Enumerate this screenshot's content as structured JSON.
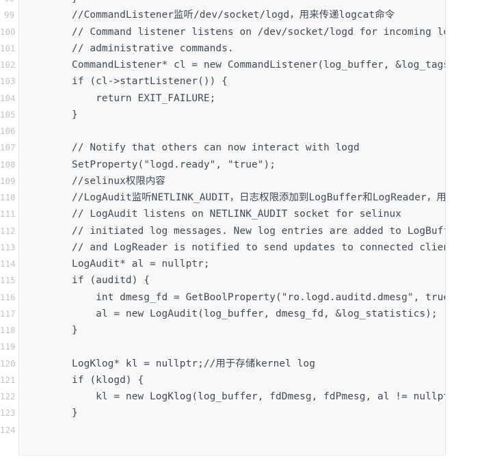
{
  "editor": {
    "language": "cpp",
    "theme": "light",
    "background_color": "#f8f8f8",
    "gutter_background_color": "#ffffff",
    "text_color": "#3b4a54",
    "line_number_color": "#bfc4c9",
    "border_color": "#e6e6e6",
    "first_visible_line": 98,
    "last_visible_line": 124,
    "horizontal_overflow": true,
    "lines": [
      {
        "number": "98",
        "text": "    }"
      },
      {
        "number": "99",
        "text": "    //CommandListener监听/dev/socket/logd，用来传递logcat命令"
      },
      {
        "number": "100",
        "text": "    // Command listener listens on /dev/socket/logd for incoming logd"
      },
      {
        "number": "101",
        "text": "    // administrative commands."
      },
      {
        "number": "102",
        "text": "    CommandListener* cl = new CommandListener(log_buffer, &log_tags, &prune_"
      },
      {
        "number": "103",
        "text": "    if (cl->startListener()) {"
      },
      {
        "number": "104",
        "text": "        return EXIT_FAILURE;"
      },
      {
        "number": "105",
        "text": "    }"
      },
      {
        "number": "106",
        "text": ""
      },
      {
        "number": "107",
        "text": "    // Notify that others can now interact with logd"
      },
      {
        "number": "108",
        "text": "    SetProperty(\"logd.ready\", \"true\");"
      },
      {
        "number": "109",
        "text": "    //selinux权限内容"
      },
      {
        "number": "110",
        "text": "    //LogAudit监听NETLINK_AUDIT，日志权限添加到LogBuffer和LogReader，用来通知客户"
      },
      {
        "number": "111",
        "text": "    // LogAudit listens on NETLINK_AUDIT socket for selinux"
      },
      {
        "number": "112",
        "text": "    // initiated log messages. New log entries are added to LogBuffer"
      },
      {
        "number": "113",
        "text": "    // and LogReader is notified to send updates to connected clients."
      },
      {
        "number": "114",
        "text": "    LogAudit* al = nullptr;"
      },
      {
        "number": "115",
        "text": "    if (auditd) {"
      },
      {
        "number": "116",
        "text": "        int dmesg_fd = GetBoolProperty(\"ro.logd.auditd.dmesg\", true) ? fdDme"
      },
      {
        "number": "117",
        "text": "        al = new LogAudit(log_buffer, dmesg_fd, &log_statistics);"
      },
      {
        "number": "118",
        "text": "    }"
      },
      {
        "number": "119",
        "text": ""
      },
      {
        "number": "120",
        "text": "    LogKlog* kl = nullptr;//用于存储kernel log"
      },
      {
        "number": "121",
        "text": "    if (klogd) {"
      },
      {
        "number": "122",
        "text": "        kl = new LogKlog(log_buffer, fdDmesg, fdPmesg, al != nullptr, &log_s"
      },
      {
        "number": "123",
        "text": "    }"
      },
      {
        "number": "124",
        "text": ""
      }
    ]
  }
}
